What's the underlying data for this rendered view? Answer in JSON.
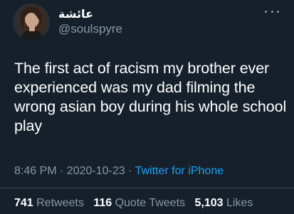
{
  "user": {
    "display_name": "عائشة",
    "handle": "@soulspyre",
    "avatar_icon": "profile-photo"
  },
  "menu": {
    "icon": "more-options-icon"
  },
  "tweet": {
    "text": "The first act of racism my brother ever experienced was my dad filming the wrong asian boy during his whole school play",
    "time": "8:46 PM",
    "separator": "·",
    "date": "2020-10-23",
    "source": "Twitter for iPhone"
  },
  "stats": {
    "retweets_count": "741",
    "retweets_label": "Retweets",
    "quote_count": "116",
    "quote_label": "Quote Tweets",
    "likes_count": "5,103",
    "likes_label": "Likes"
  },
  "colors": {
    "background": "#15202b",
    "text": "#ffffff",
    "secondary": "#8899a6",
    "link": "#1da1f2",
    "divider": "#38444d"
  }
}
